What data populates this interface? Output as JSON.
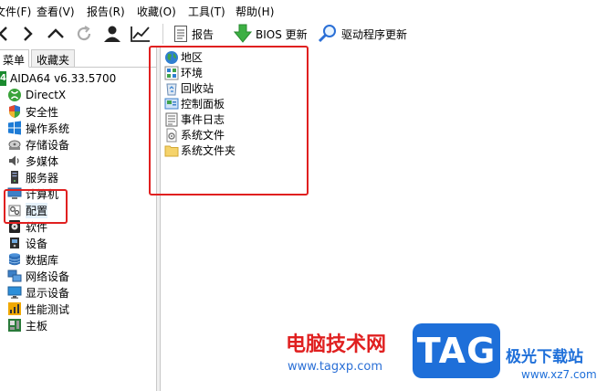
{
  "menubar": {
    "items": [
      "文件(F)",
      "查看(V)",
      "报告(R)",
      "收藏(O)",
      "工具(T)",
      "帮助(H)"
    ]
  },
  "toolbar": {
    "report_label": "报告",
    "bios_label": "BIOS 更新",
    "driver_label": "驱动程序更新"
  },
  "left": {
    "tabs": [
      "菜单",
      "收藏夹"
    ],
    "root_label": "AIDA64 v6.33.5700",
    "items": [
      {
        "label": "DirectX",
        "icon": "xbox-icon"
      },
      {
        "label": "安全性",
        "icon": "shield-icon"
      },
      {
        "label": "操作系统",
        "icon": "windows-icon"
      },
      {
        "label": "存储设备",
        "icon": "disk-icon"
      },
      {
        "label": "多媒体",
        "icon": "speaker-icon"
      },
      {
        "label": "服务器",
        "icon": "server-icon"
      },
      {
        "label": "计算机",
        "icon": "computer-icon"
      },
      {
        "label": "配置",
        "icon": "config-icon"
      },
      {
        "label": "软件",
        "icon": "software-icon"
      },
      {
        "label": "设备",
        "icon": "device-icon"
      },
      {
        "label": "数据库",
        "icon": "database-icon"
      },
      {
        "label": "网络设备",
        "icon": "network-icon"
      },
      {
        "label": "显示设备",
        "icon": "monitor-icon"
      },
      {
        "label": "性能测试",
        "icon": "benchmark-icon"
      },
      {
        "label": "主板",
        "icon": "motherboard-icon"
      }
    ]
  },
  "right": {
    "items": [
      {
        "label": "地区",
        "icon": "globe-icon"
      },
      {
        "label": "环境",
        "icon": "environment-icon"
      },
      {
        "label": "回收站",
        "icon": "recycle-bin-icon"
      },
      {
        "label": "控制面板",
        "icon": "control-panel-icon"
      },
      {
        "label": "事件日志",
        "icon": "event-log-icon"
      },
      {
        "label": "系统文件",
        "icon": "system-file-icon"
      },
      {
        "label": "系统文件夹",
        "icon": "folder-icon"
      }
    ]
  },
  "watermark": {
    "site_cn": "电脑技术网",
    "site_url": "www.tagxp.com",
    "tag": "TAG",
    "brand_cn": "极光下载站",
    "brand_url": "www.xz7.com"
  },
  "colors": {
    "highlight": "#e02020",
    "selected": "#e5f1fb",
    "tag_blue": "#1e6fd9",
    "watermark_red": "#e02020"
  }
}
